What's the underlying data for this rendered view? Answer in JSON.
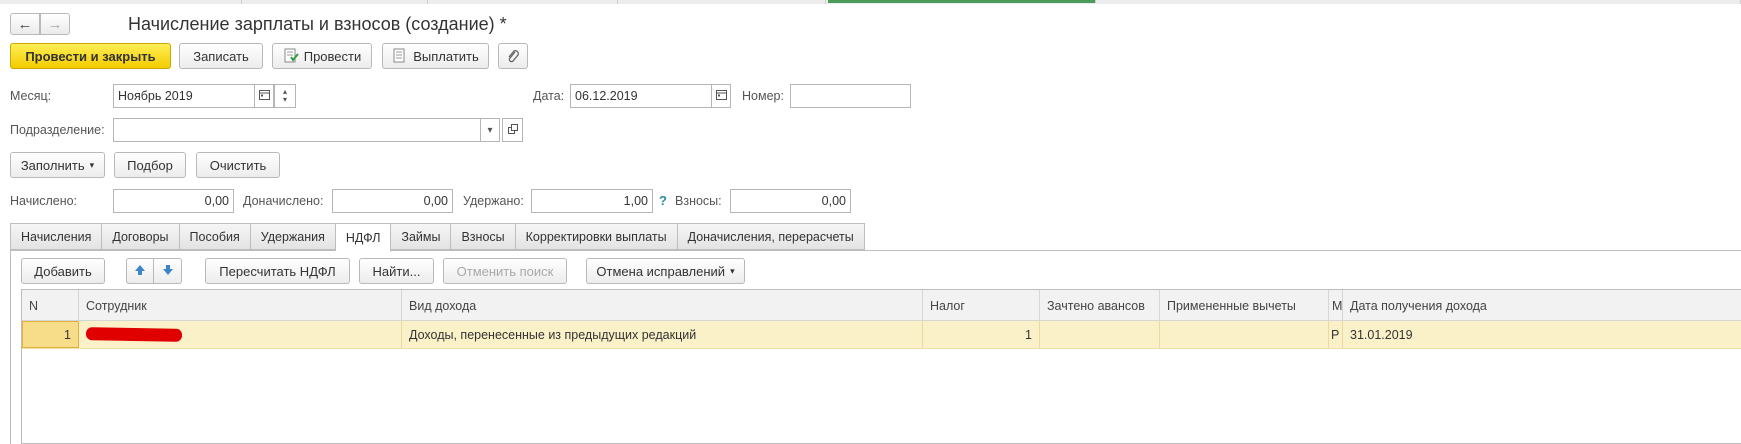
{
  "window": {
    "title": "Начисление зарплаты и взносов (создание) *"
  },
  "toolbar": {
    "post_close": "Провести и закрыть",
    "save": "Записать",
    "post": "Провести",
    "pay": "Выплатить"
  },
  "form": {
    "month_label": "Месяц:",
    "month_value": "Ноябрь 2019",
    "date_label": "Дата:",
    "date_value": "06.12.2019",
    "number_label": "Номер:",
    "number_value": "",
    "division_label": "Подразделение:",
    "division_value": ""
  },
  "actions": {
    "fill": "Заполнить",
    "pick": "Подбор",
    "clear": "Очистить"
  },
  "totals": {
    "accrued_label": "Начислено:",
    "accrued_value": "0,00",
    "extra_label": "Доначислено:",
    "extra_value": "0,00",
    "withheld_label": "Удержано:",
    "withheld_value": "1,00",
    "help": "?",
    "contrib_label": "Взносы:",
    "contrib_value": "0,00"
  },
  "tabs": [
    {
      "label": "Начисления"
    },
    {
      "label": "Договоры"
    },
    {
      "label": "Пособия"
    },
    {
      "label": "Удержания"
    },
    {
      "label": "НДФЛ",
      "active": true
    },
    {
      "label": "Займы"
    },
    {
      "label": "Взносы"
    },
    {
      "label": "Корректировки выплаты"
    },
    {
      "label": "Доначисления, перерасчеты"
    }
  ],
  "table_toolbar": {
    "add": "Добавить",
    "recalc": "Пересчитать НДФЛ",
    "find": "Найти...",
    "cancel_search": "Отменить поиск",
    "cancel_fix": "Отмена исправлений"
  },
  "table": {
    "columns": [
      "N",
      "Сотрудник",
      "Вид дохода",
      "Налог",
      "Зачтено авансов",
      "Примененные вычеты",
      "М",
      "Дата получения дохода"
    ],
    "rows": [
      {
        "n": "1",
        "employee": "",
        "income_type": "Доходы, перенесенные из предыдущих редакций",
        "tax": "1",
        "advances": "",
        "deductions": "",
        "m": "Р",
        "date": "31.01.2019"
      }
    ]
  },
  "colors": {
    "primary_button": "#f3cc00",
    "row_highlight": "#fbf1c8",
    "redaction": "#e00000"
  }
}
